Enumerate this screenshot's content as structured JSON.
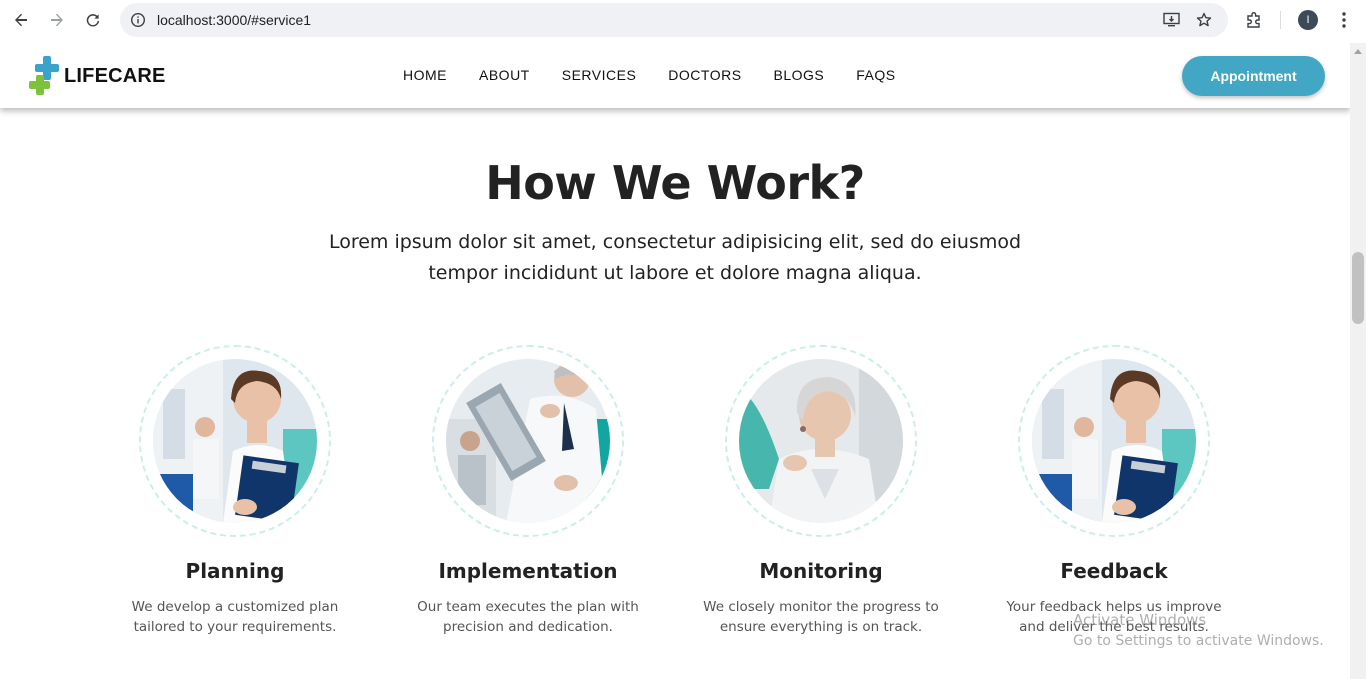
{
  "browser": {
    "url": "localhost:3000/#service1",
    "profile_initial": "I"
  },
  "header": {
    "logo_text": "LIFECARE",
    "menu": [
      {
        "label": "HOME"
      },
      {
        "label": "ABOUT"
      },
      {
        "label": "SERVICES"
      },
      {
        "label": "DOCTORS"
      },
      {
        "label": "BLOGS"
      },
      {
        "label": "FAQS"
      }
    ],
    "appointment_label": "Appointment"
  },
  "section": {
    "title": "How We Work?",
    "subtitle_line1": "Lorem ipsum dolor sit amet, consectetur adipisicing elit, sed do eiusmod",
    "subtitle_line2": "tempor incididunt ut labore et dolore magna aliqua."
  },
  "steps": [
    {
      "title": "Planning",
      "desc_line1": "We develop a customized plan",
      "desc_line2": "tailored to your requirements."
    },
    {
      "title": "Implementation",
      "desc_line1": "Our team executes the plan with",
      "desc_line2": "precision and dedication."
    },
    {
      "title": "Monitoring",
      "desc_line1": "We closely monitor the progress to",
      "desc_line2": "ensure everything is on track."
    },
    {
      "title": "Feedback",
      "desc_line1": "Your feedback helps us improve",
      "desc_line2": "and deliver the best results."
    }
  ],
  "watermark": {
    "line1": "Activate Windows",
    "line2": "Go to Settings to activate Windows."
  },
  "colors": {
    "accent": "#42a7c4",
    "logo_blue": "#3aa3c9",
    "logo_green": "#7cc23b",
    "circle_dash": "#cdeee8"
  },
  "icons": [
    "back-arrow-icon",
    "forward-arrow-icon",
    "reload-icon",
    "site-info-icon",
    "install-app-icon",
    "bookmark-star-icon",
    "extensions-icon",
    "more-menu-icon"
  ]
}
